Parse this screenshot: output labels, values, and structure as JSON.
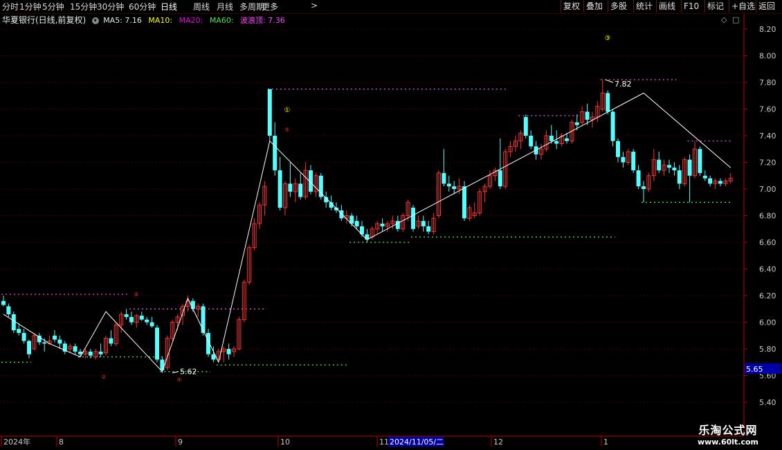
{
  "toolbar": {
    "periods": [
      "分时",
      "1分钟",
      "5分钟",
      "15分钟",
      "30分钟",
      "60分钟",
      "日线",
      "周线",
      "月线",
      "多周期",
      "更多"
    ],
    "active_period": "日线",
    "buttons": [
      "复权",
      "叠加",
      "多股",
      "统计",
      "画线",
      "F10",
      "标记",
      "+自选",
      "返回"
    ]
  },
  "info": {
    "stock_name": "华夏银行(日线,前复权)",
    "ma5_label": "MA5: 7.16",
    "ma10_label": "MA10:",
    "ma20_label": "MA20:",
    "ma60_label": "MA60:",
    "wave_label": "波浪顶: 7.36"
  },
  "price_axis": {
    "ticks": [
      "8.20",
      "8.00",
      "7.80",
      "7.60",
      "7.40",
      "7.20",
      "7.00",
      "6.80",
      "6.60",
      "6.40",
      "6.20",
      "6.00",
      "5.80",
      "5.60",
      "5.40"
    ],
    "current_price": "5.65"
  },
  "time_axis": {
    "labels": [
      "2024年",
      "8",
      "9",
      "10",
      "11",
      "12",
      "1"
    ],
    "cursor_date": "2024/11/05/二"
  },
  "annotations": {
    "high_label": "7.82",
    "low_label": "5.62",
    "markers": [
      "①",
      "②",
      "③",
      "④",
      "⑤"
    ]
  },
  "watermark": {
    "line1": "乐淘公式网",
    "line2": "www.60lt.com"
  },
  "colors": {
    "up": "#ff3232",
    "down": "#54ffff",
    "wave": "#ffffff",
    "top_line": "#ff55ff",
    "bottom_line": "#55ff55",
    "axis": "#c00000",
    "grid": "#7a0000"
  },
  "chart_data": {
    "type": "candlestick",
    "ylim": [
      5.3,
      8.28
    ],
    "candles": [
      [
        6.16,
        6.2,
        6.12,
        6.13
      ],
      [
        6.12,
        6.14,
        6.04,
        6.06
      ],
      [
        6.06,
        6.08,
        5.92,
        5.94
      ],
      [
        5.95,
        5.99,
        5.9,
        5.92
      ],
      [
        5.92,
        5.95,
        5.84,
        5.86
      ],
      [
        5.86,
        5.87,
        5.73,
        5.76
      ],
      [
        5.8,
        5.92,
        5.79,
        5.9
      ],
      [
        5.9,
        5.92,
        5.83,
        5.85
      ],
      [
        5.85,
        5.88,
        5.78,
        5.84
      ],
      [
        5.84,
        5.9,
        5.83,
        5.86
      ],
      [
        5.9,
        5.94,
        5.85,
        5.87
      ],
      [
        5.87,
        5.9,
        5.8,
        5.84
      ],
      [
        5.84,
        5.86,
        5.76,
        5.78
      ],
      [
        5.8,
        5.84,
        5.77,
        5.82
      ],
      [
        5.82,
        5.84,
        5.76,
        5.78
      ],
      [
        5.78,
        5.8,
        5.74,
        5.76
      ],
      [
        5.76,
        5.8,
        5.73,
        5.78
      ],
      [
        5.78,
        5.8,
        5.73,
        5.75
      ],
      [
        5.74,
        5.8,
        5.72,
        5.78
      ],
      [
        5.78,
        5.84,
        5.74,
        5.76
      ],
      [
        5.77,
        5.9,
        5.75,
        5.88
      ],
      [
        5.88,
        5.94,
        5.82,
        5.84
      ],
      [
        5.84,
        6.0,
        5.82,
        5.98
      ],
      [
        5.98,
        6.08,
        5.92,
        6.06
      ],
      [
        6.06,
        6.1,
        6.02,
        6.04
      ],
      [
        6.04,
        6.08,
        5.98,
        6.0
      ],
      [
        6.0,
        6.06,
        5.96,
        6.05
      ],
      [
        6.05,
        6.08,
        6.01,
        6.02
      ],
      [
        6.02,
        6.04,
        5.98,
        6.0
      ],
      [
        6.0,
        6.04,
        5.96,
        5.97
      ],
      [
        5.96,
        5.98,
        5.7,
        5.72
      ],
      [
        5.72,
        5.74,
        5.62,
        5.64
      ],
      [
        5.66,
        5.9,
        5.64,
        5.88
      ],
      [
        5.88,
        6.02,
        5.86,
        6.0
      ],
      [
        6.0,
        6.06,
        5.94,
        6.04
      ],
      [
        6.05,
        6.14,
        5.98,
        6.12
      ],
      [
        6.12,
        6.2,
        6.08,
        6.16
      ],
      [
        6.16,
        6.18,
        6.08,
        6.1
      ],
      [
        6.1,
        6.14,
        6.04,
        6.12
      ],
      [
        6.12,
        6.14,
        5.9,
        5.92
      ],
      [
        5.92,
        5.95,
        5.74,
        5.76
      ],
      [
        5.76,
        5.82,
        5.7,
        5.72
      ],
      [
        5.72,
        5.8,
        5.7,
        5.78
      ],
      [
        5.78,
        5.82,
        5.7,
        5.8
      ],
      [
        5.8,
        5.84,
        5.72,
        5.76
      ],
      [
        5.78,
        5.82,
        5.74,
        5.8
      ],
      [
        5.8,
        6.04,
        5.79,
        6.02
      ],
      [
        6.02,
        6.32,
        6.0,
        6.3
      ],
      [
        6.3,
        6.58,
        6.28,
        6.56
      ],
      [
        6.56,
        6.78,
        6.54,
        6.74
      ],
      [
        6.74,
        6.9,
        6.7,
        6.88
      ],
      [
        6.88,
        7.06,
        6.8,
        7.02
      ],
      [
        7.75,
        7.75,
        7.36,
        7.4
      ],
      [
        7.4,
        7.5,
        7.1,
        7.14
      ],
      [
        7.14,
        7.24,
        6.84,
        6.86
      ],
      [
        6.86,
        7.06,
        6.8,
        7.04
      ],
      [
        7.04,
        7.2,
        6.94,
        6.98
      ],
      [
        6.98,
        7.08,
        6.9,
        7.04
      ],
      [
        7.04,
        7.12,
        6.92,
        6.94
      ],
      [
        6.94,
        7.2,
        6.92,
        7.14
      ],
      [
        7.14,
        7.18,
        6.96,
        6.98
      ],
      [
        6.98,
        7.12,
        6.94,
        7.1
      ],
      [
        7.1,
        7.12,
        6.92,
        6.94
      ],
      [
        6.94,
        6.98,
        6.86,
        6.9
      ],
      [
        6.9,
        6.95,
        6.84,
        6.86
      ],
      [
        6.86,
        6.9,
        6.82,
        6.84
      ],
      [
        6.84,
        6.88,
        6.76,
        6.78
      ],
      [
        6.78,
        6.84,
        6.74,
        6.8
      ],
      [
        6.8,
        6.82,
        6.72,
        6.74
      ],
      [
        6.76,
        6.8,
        6.7,
        6.72
      ],
      [
        6.72,
        6.76,
        6.64,
        6.66
      ],
      [
        6.66,
        6.7,
        6.6,
        6.62
      ],
      [
        6.64,
        6.72,
        6.62,
        6.7
      ],
      [
        6.7,
        6.76,
        6.66,
        6.74
      ],
      [
        6.74,
        6.78,
        6.68,
        6.72
      ],
      [
        6.72,
        6.76,
        6.68,
        6.74
      ],
      [
        6.74,
        6.8,
        6.7,
        6.76
      ],
      [
        6.76,
        6.8,
        6.68,
        6.7
      ],
      [
        6.7,
        6.82,
        6.68,
        6.8
      ],
      [
        6.8,
        6.92,
        6.76,
        6.9
      ],
      [
        6.86,
        6.88,
        6.68,
        6.7
      ],
      [
        6.72,
        6.8,
        6.7,
        6.76
      ],
      [
        6.76,
        6.8,
        6.68,
        6.72
      ],
      [
        6.72,
        6.76,
        6.66,
        6.68
      ],
      [
        6.68,
        6.82,
        6.66,
        6.78
      ],
      [
        6.8,
        7.14,
        6.78,
        7.12
      ],
      [
        7.12,
        7.3,
        7.02,
        7.04
      ],
      [
        7.04,
        7.1,
        6.98,
        7.02
      ],
      [
        7.02,
        7.06,
        6.96,
        7.0
      ],
      [
        7.0,
        7.08,
        6.96,
        7.02
      ],
      [
        7.02,
        7.06,
        6.76,
        6.78
      ],
      [
        6.78,
        6.88,
        6.76,
        6.86
      ],
      [
        6.8,
        6.9,
        6.78,
        6.82
      ],
      [
        6.82,
        7.0,
        6.8,
        6.98
      ],
      [
        6.98,
        7.04,
        6.9,
        7.02
      ],
      [
        7.02,
        7.14,
        7.0,
        7.1
      ],
      [
        7.1,
        7.16,
        7.06,
        7.14
      ],
      [
        7.14,
        7.38,
        7.0,
        7.02
      ],
      [
        7.02,
        7.3,
        7.0,
        7.28
      ],
      [
        7.28,
        7.36,
        7.24,
        7.32
      ],
      [
        7.32,
        7.4,
        7.28,
        7.36
      ],
      [
        7.36,
        7.44,
        7.3,
        7.42
      ],
      [
        7.54,
        7.56,
        7.38,
        7.4
      ],
      [
        7.4,
        7.44,
        7.3,
        7.32
      ],
      [
        7.32,
        7.36,
        7.22,
        7.26
      ],
      [
        7.26,
        7.34,
        7.22,
        7.3
      ],
      [
        7.3,
        7.44,
        7.28,
        7.4
      ],
      [
        7.4,
        7.48,
        7.34,
        7.36
      ],
      [
        7.36,
        7.44,
        7.3,
        7.34
      ],
      [
        7.34,
        7.42,
        7.32,
        7.4
      ],
      [
        7.38,
        7.42,
        7.34,
        7.36
      ],
      [
        7.36,
        7.52,
        7.34,
        7.5
      ],
      [
        7.5,
        7.56,
        7.44,
        7.48
      ],
      [
        7.5,
        7.62,
        7.48,
        7.58
      ],
      [
        7.58,
        7.64,
        7.48,
        7.52
      ],
      [
        7.52,
        7.58,
        7.46,
        7.54
      ],
      [
        7.54,
        7.66,
        7.5,
        7.62
      ],
      [
        7.6,
        7.82,
        7.58,
        7.72
      ],
      [
        7.72,
        7.74,
        7.56,
        7.58
      ],
      [
        7.58,
        7.6,
        7.32,
        7.36
      ],
      [
        7.36,
        7.38,
        7.2,
        7.24
      ],
      [
        7.24,
        7.28,
        7.16,
        7.2
      ],
      [
        7.2,
        7.3,
        7.18,
        7.28
      ],
      [
        7.28,
        7.3,
        7.12,
        7.14
      ],
      [
        7.14,
        7.18,
        7.0,
        7.02
      ],
      [
        7.02,
        7.06,
        6.9,
        7.0
      ],
      [
        7.0,
        7.12,
        6.98,
        7.1
      ],
      [
        7.1,
        7.3,
        7.06,
        7.22
      ],
      [
        7.22,
        7.28,
        7.12,
        7.14
      ],
      [
        7.14,
        7.22,
        7.1,
        7.18
      ],
      [
        7.18,
        7.22,
        7.12,
        7.16
      ],
      [
        7.16,
        7.2,
        7.1,
        7.14
      ],
      [
        7.14,
        7.18,
        7.0,
        7.04
      ],
      [
        7.04,
        7.24,
        7.02,
        7.22
      ],
      [
        7.22,
        7.26,
        6.9,
        7.1
      ],
      [
        7.1,
        7.36,
        7.08,
        7.3
      ],
      [
        7.3,
        7.32,
        7.1,
        7.12
      ],
      [
        7.1,
        7.14,
        7.06,
        7.08
      ],
      [
        7.08,
        7.1,
        7.02,
        7.04
      ],
      [
        7.04,
        7.08,
        7.0,
        7.06
      ],
      [
        7.06,
        7.08,
        7.02,
        7.04
      ],
      [
        7.04,
        7.08,
        7.02,
        7.06
      ],
      [
        7.06,
        7.12,
        7.04,
        7.08
      ]
    ],
    "wave_line": [
      [
        0,
        6.06
      ],
      [
        9,
        5.84
      ],
      [
        15,
        5.74
      ],
      [
        20,
        6.08
      ],
      [
        31,
        5.63
      ],
      [
        36,
        6.18
      ],
      [
        42,
        5.7
      ],
      [
        52,
        7.36
      ],
      [
        71,
        6.62
      ],
      [
        125,
        7.72
      ],
      [
        142,
        7.16
      ]
    ],
    "top_lines": [
      [
        0,
        24,
        6.21
      ],
      [
        25,
        51,
        6.1
      ],
      [
        52,
        98,
        7.75
      ],
      [
        101,
        112,
        7.55
      ],
      [
        117,
        131,
        7.82
      ],
      [
        134,
        142,
        7.36
      ]
    ],
    "bottom_lines": [
      [
        0,
        5,
        5.7
      ],
      [
        15,
        31,
        5.74
      ],
      [
        31,
        40,
        5.63
      ],
      [
        42,
        67,
        5.68
      ],
      [
        68,
        79,
        6.6
      ],
      [
        80,
        119,
        6.64
      ],
      [
        125,
        142,
        6.9
      ]
    ]
  }
}
